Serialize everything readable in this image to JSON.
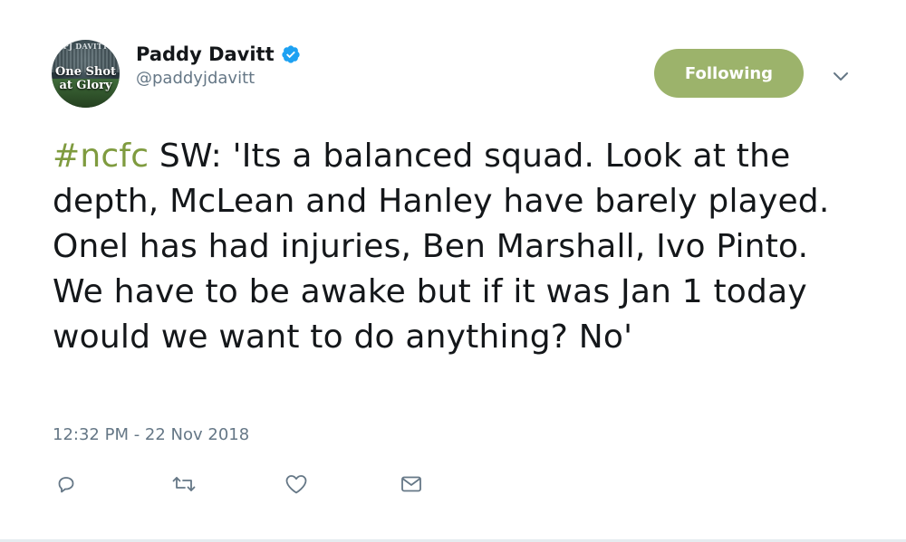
{
  "user": {
    "display_name": "Paddy Davitt",
    "handle": "@paddyjdavitt",
    "verified": true,
    "avatar": {
      "top_text": "PJ DAVITT",
      "line1": "One Shot",
      "line2": "at Glory"
    }
  },
  "follow_button": {
    "label": "Following",
    "color": "#9cb36b"
  },
  "tweet": {
    "hashtag": "#ncfc",
    "text": " SW: 'Its a balanced squad. Look at the depth, McLean and Hanley have barely played. Onel has had injuries, Ben Marshall, Ivo Pinto. We have to be awake but if it was Jan 1 today would we want to do anything? No'",
    "hashtag_color": "#7f9b3f",
    "timestamp": "12:32 PM - 22 Nov 2018"
  },
  "actions": [
    {
      "icon": "reply-icon"
    },
    {
      "icon": "retweet-icon"
    },
    {
      "icon": "like-icon"
    },
    {
      "icon": "direct-message-icon"
    }
  ],
  "colors": {
    "icon_gray": "#657786",
    "verified_blue": "#1da1f2"
  }
}
